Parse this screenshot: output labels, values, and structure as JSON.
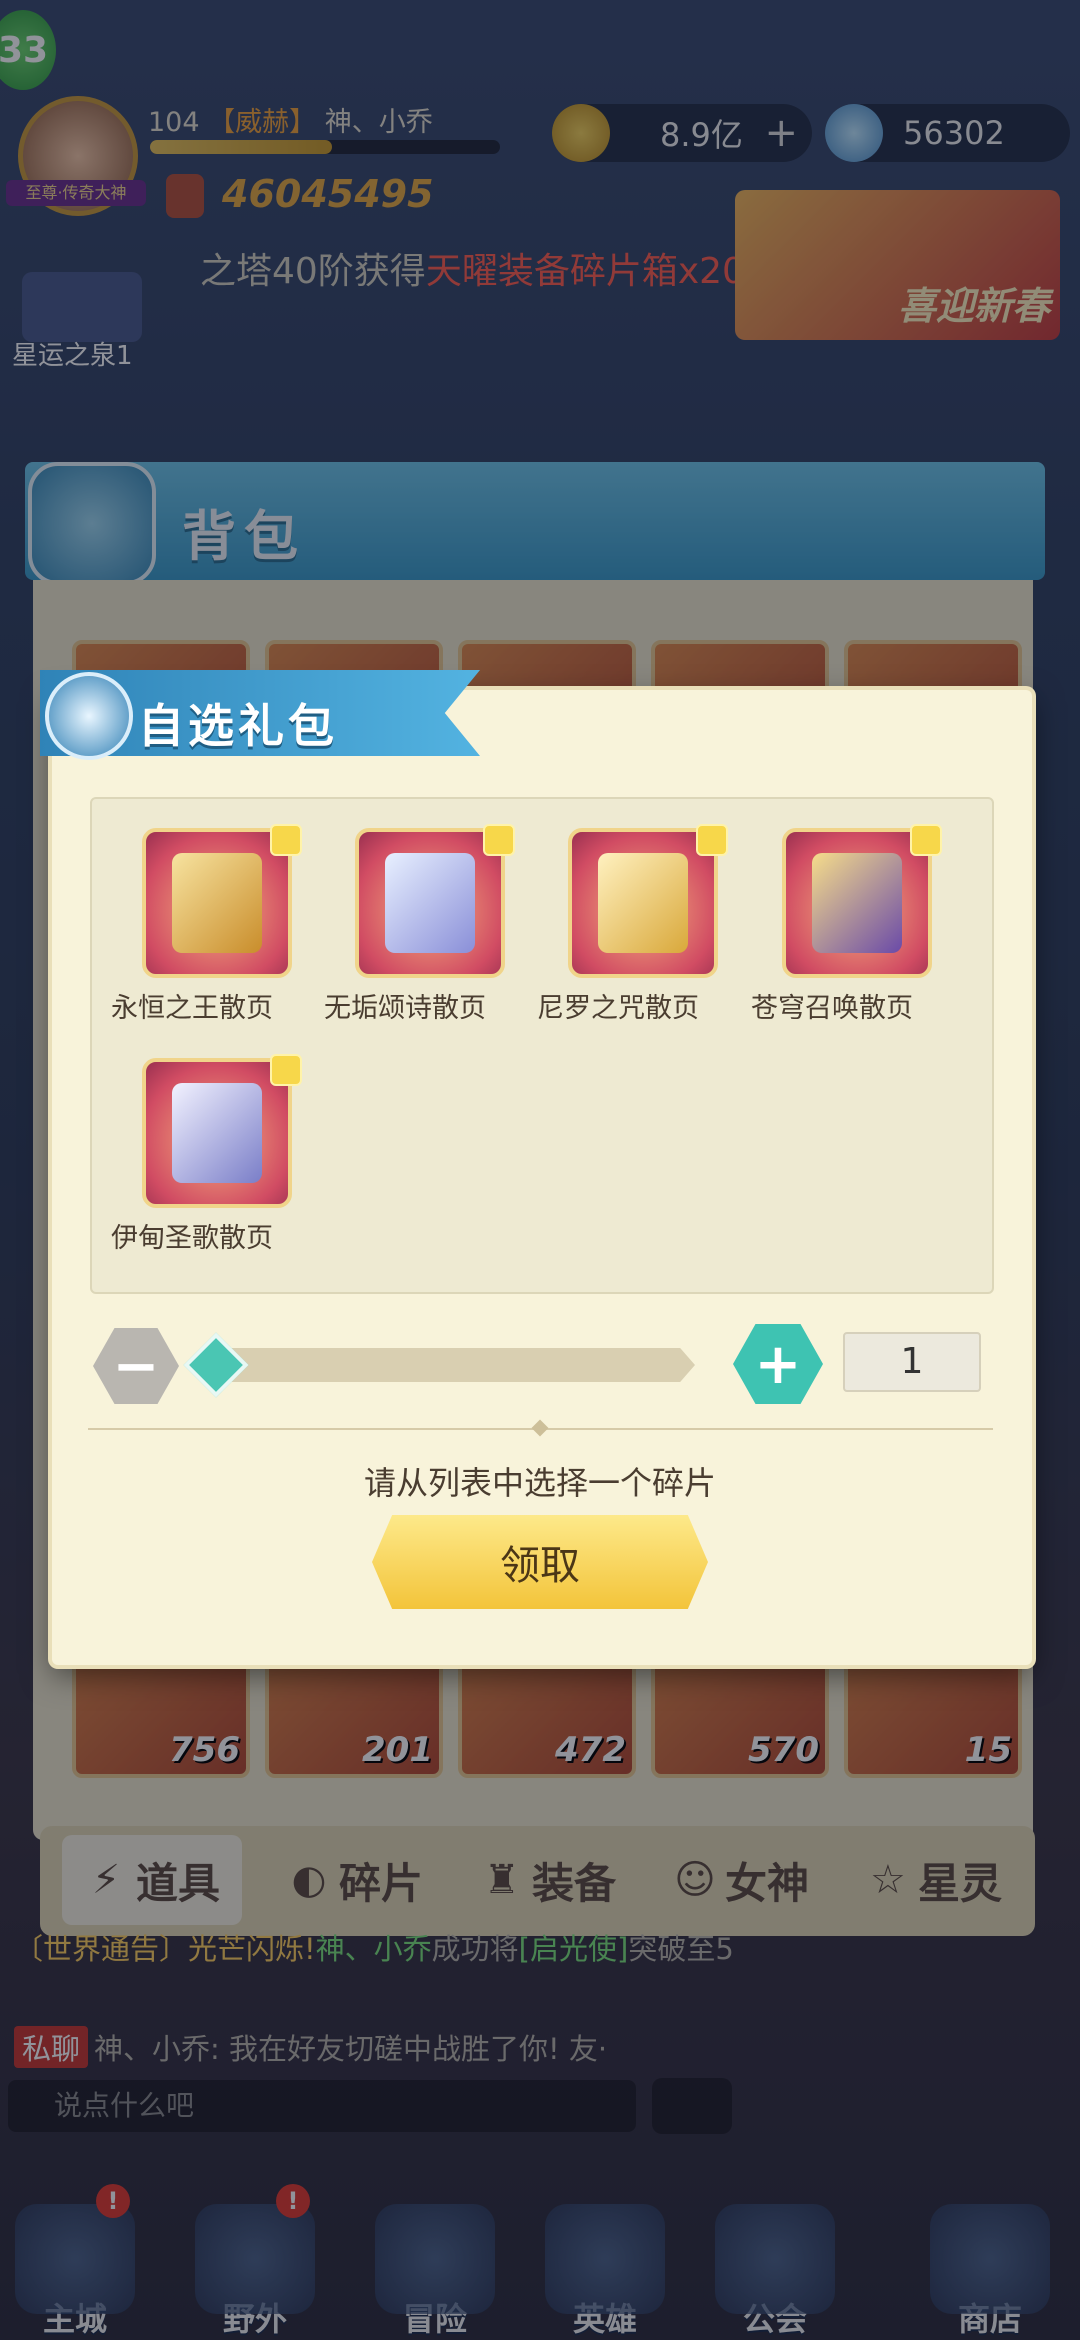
{
  "hud": {
    "level": "33",
    "avatar_tag": "至尊·传奇大神",
    "player_level": "104",
    "guild": "【威赫】",
    "player_name": "神、小乔",
    "power": "46045495",
    "gold": "8.9亿",
    "diamonds": "56302",
    "marquee_prefix": "之塔40阶获得",
    "marquee_item": "天曜装备碎片箱x20",
    "marquee_suffix": "!",
    "banner_text": "喜迎新春",
    "side_label": "星运之泉1"
  },
  "backpack": {
    "title": "背包",
    "visible_counts": [
      "756",
      "201",
      "472",
      "570",
      "15"
    ],
    "tabs": [
      "道具",
      "碎片",
      "装备",
      "女神",
      "星灵"
    ],
    "active_tab": "道具"
  },
  "dialog": {
    "title": "自选礼包",
    "items": [
      {
        "name": "永恒之王散页"
      },
      {
        "name": "无垢颂诗散页"
      },
      {
        "name": "尼罗之咒散页"
      },
      {
        "name": "苍穹召唤散页"
      },
      {
        "name": "伊甸圣歌散页"
      }
    ],
    "minus": "−",
    "plus": "+",
    "quantity": "1",
    "hint": "请从列表中选择一个碎片",
    "claim_button": "领取"
  },
  "chat": {
    "line1_sys": "〔世界通告〕光芒闪烁!",
    "line1_name": "神、小乔",
    "line1_text": "成功将",
    "line1_hero": "[启光使]",
    "line1_end": "突破至5",
    "private_tag": "私聊",
    "line2_text": "神、小乔: 我在好友切磋中战胜了你! 友·",
    "input_placeholder": "说点什么吧"
  },
  "nav": [
    {
      "label": "主城",
      "badge": "!"
    },
    {
      "label": "野外",
      "badge": "!"
    },
    {
      "label": "冒险",
      "badge": ""
    },
    {
      "label": "英雄",
      "badge": ""
    },
    {
      "label": "公会",
      "badge": ""
    },
    {
      "label": "商店",
      "badge": ""
    }
  ],
  "colors": {
    "accent_teal": "#3ec3b2",
    "claim_yellow": "#f3c43a",
    "dialog_bg": "#f8f3da",
    "title_blue": "#3a9bc8"
  }
}
